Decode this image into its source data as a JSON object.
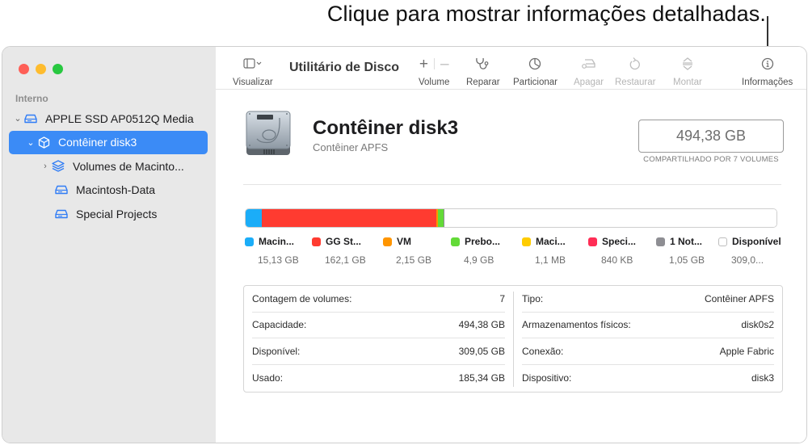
{
  "callout": {
    "text": "Clique para mostrar informações detalhadas."
  },
  "window": {
    "traffic_lights": [
      "close",
      "minimize",
      "zoom"
    ]
  },
  "sidebar": {
    "section_label": "Interno",
    "items": [
      {
        "label": "APPLE SSD AP0512Q Media",
        "icon": "internal-drive-icon",
        "chevron": "expanded",
        "level": 0
      },
      {
        "label": "Contêiner disk3",
        "icon": "container-cube-icon",
        "chevron": "expanded",
        "level": 1,
        "selected": true
      },
      {
        "label": "Volumes de Macinto...",
        "icon": "volume-stack-icon",
        "chevron": "collapsed",
        "level": 2
      },
      {
        "label": "Macintosh-Data",
        "icon": "volume-drive-icon",
        "chevron": "none",
        "level": 2
      },
      {
        "label": "Special Projects",
        "icon": "volume-drive-icon",
        "chevron": "none",
        "level": 2
      }
    ]
  },
  "toolbar": {
    "title": "Utilitário de Disco",
    "view_label": "Visualizar",
    "volume_label": "Volume",
    "repair_label": "Reparar",
    "partition_label": "Particionar",
    "erase_label": "Apagar",
    "restore_label": "Restaurar",
    "mount_label": "Montar",
    "info_label": "Informações"
  },
  "disk": {
    "title": "Contêiner disk3",
    "subtitle": "Contêiner APFS",
    "capacity": "494,38 GB",
    "capacity_note": "COMPARTILHADO POR 7 VOLUMES"
  },
  "usage": {
    "segments": [
      {
        "name": "Macin...",
        "value": "15,13 GB",
        "color": "#1badf8",
        "fraction": 0.0306
      },
      {
        "name": "GG St...",
        "value": "162,1 GB",
        "color": "#ff3b30",
        "fraction": 0.3279
      },
      {
        "name": "VM",
        "value": "2,15 GB",
        "color": "#ff9500",
        "fraction": 0.0043
      },
      {
        "name": "Prebo...",
        "value": "4,9 GB",
        "color": "#63da38",
        "fraction": 0.0099
      },
      {
        "name": "Maci...",
        "value": "1,1 MB",
        "color": "#ffcc00",
        "fraction": 0.0
      },
      {
        "name": "Speci...",
        "value": "840 KB",
        "color": "#ff2d55",
        "fraction": 0.0
      },
      {
        "name": "1 Not...",
        "value": "1,05 GB",
        "color": "#8e8e93",
        "fraction": 0.0021
      },
      {
        "name": "Disponível",
        "value": "309,0...",
        "color": "#ffffff",
        "fraction": 0.6251
      }
    ]
  },
  "info": {
    "left": [
      {
        "label": "Contagem de volumes:",
        "value": "7"
      },
      {
        "label": "Capacidade:",
        "value": "494,38 GB"
      },
      {
        "label": "Disponível:",
        "value": "309,05 GB"
      },
      {
        "label": "Usado:",
        "value": "185,34 GB"
      }
    ],
    "right": [
      {
        "label": "Tipo:",
        "value": "Contêiner APFS"
      },
      {
        "label": "Armazenamentos físicos:",
        "value": "disk0s2"
      },
      {
        "label": "Conexão:",
        "value": "Apple Fabric"
      },
      {
        "label": "Dispositivo:",
        "value": "disk3"
      }
    ]
  }
}
